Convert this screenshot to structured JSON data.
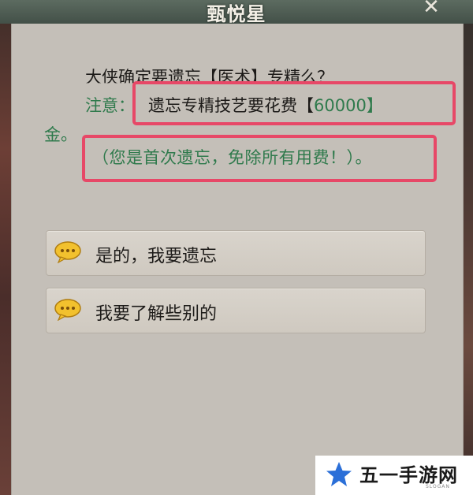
{
  "dialog": {
    "title": "甄悦星",
    "close_label": "✕",
    "question": "大侠确定要遗忘【医术】专精么？",
    "note_label": "注意：",
    "note_text_before": "遗忘专精技艺要花费【",
    "note_amount": "60000",
    "note_text_after": "】",
    "note_tail": "金。",
    "free_notice": "（您是首次遗忘，免除所有用费！）。"
  },
  "options": [
    {
      "label": "是的，我要遗忘",
      "icon": "speech-bubble-icon"
    },
    {
      "label": "我要了解些别的",
      "icon": "speech-bubble-icon"
    }
  ],
  "watermark": {
    "text": "五一手游网",
    "sub": "SLOGAN",
    "icon": "blue-star-icon"
  },
  "colors": {
    "highlight_border": "#e74867",
    "note_green": "#2f7a4c",
    "panel_bg": "#c4bfb8"
  }
}
